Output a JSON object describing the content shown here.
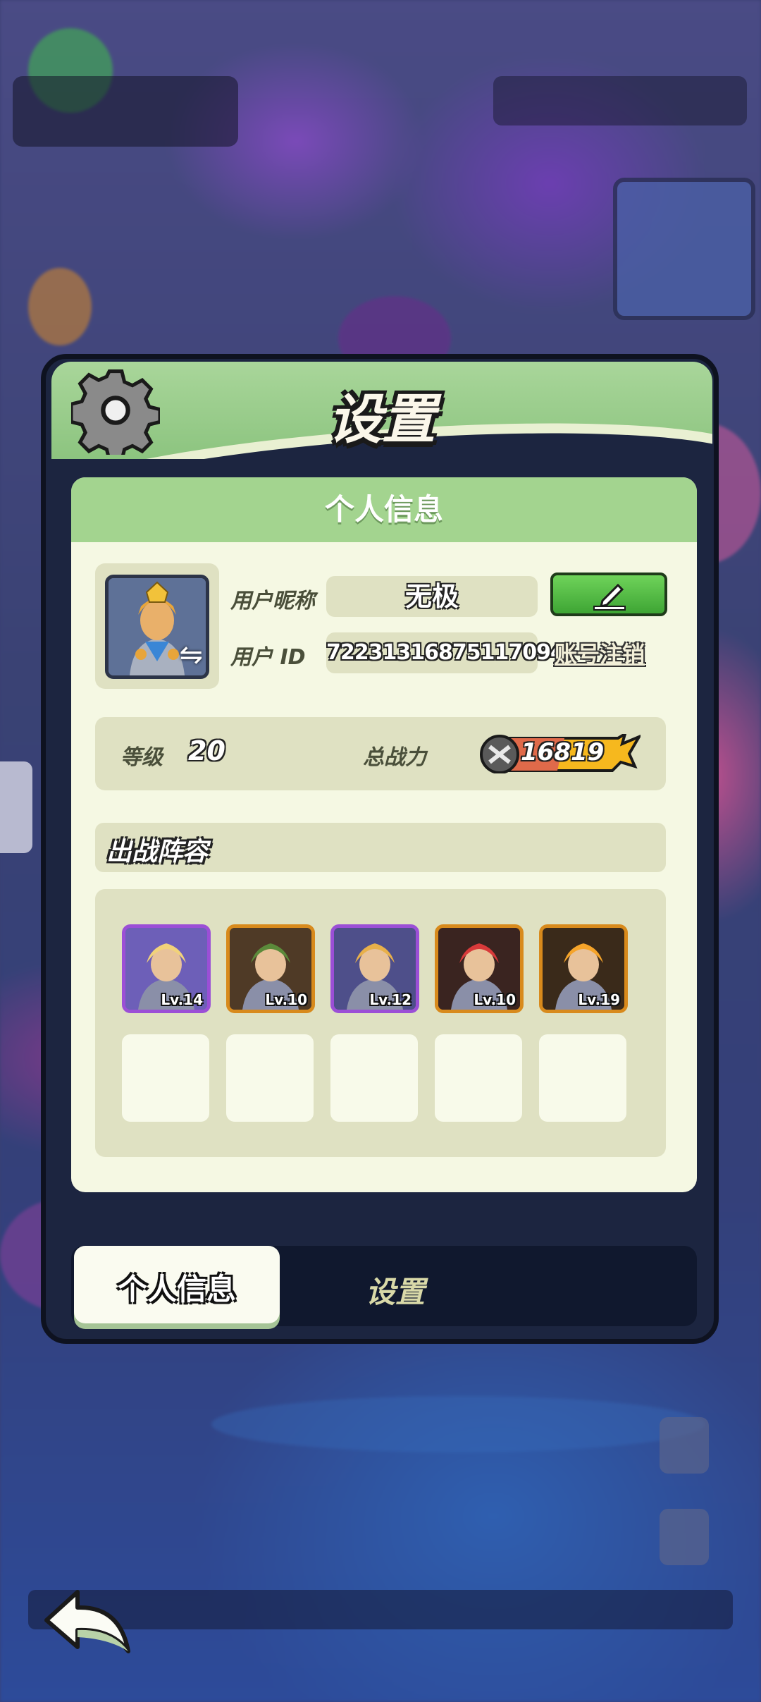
{
  "dialog": {
    "title": "设置",
    "panel_title": "个人信息"
  },
  "profile": {
    "nickname_label": "用户昵称",
    "nickname": "无极",
    "id_label": "用户 ID",
    "user_id": "72231316875117094",
    "cancel_account": "账号注销",
    "level_label": "等级",
    "level": "20",
    "power_label": "总战力",
    "power": "16819"
  },
  "lineup": {
    "title": "出战阵容",
    "heroes": [
      {
        "level": "Lv.14",
        "frame": "#9b4fd6",
        "bg": "#6d5fb8",
        "hair": "#f1d27a"
      },
      {
        "level": "Lv.10",
        "frame": "#d88a1c",
        "bg": "#4f3a26",
        "hair": "#5b8a3a"
      },
      {
        "level": "Lv.12",
        "frame": "#9b4fd6",
        "bg": "#4e4f8a",
        "hair": "#e8b04a"
      },
      {
        "level": "Lv.10",
        "frame": "#d88a1c",
        "bg": "#3a2420",
        "hair": "#d83a3a"
      },
      {
        "level": "Lv.19",
        "frame": "#d88a1c",
        "bg": "#3a2a1a",
        "hair": "#f5a42a"
      }
    ]
  },
  "tabs": {
    "profile": "个人信息",
    "settings": "设置"
  },
  "colors": {
    "header_green": "#8cc47f",
    "panel_bg": "#f5f8e3",
    "edit_green": "#3ea534"
  }
}
